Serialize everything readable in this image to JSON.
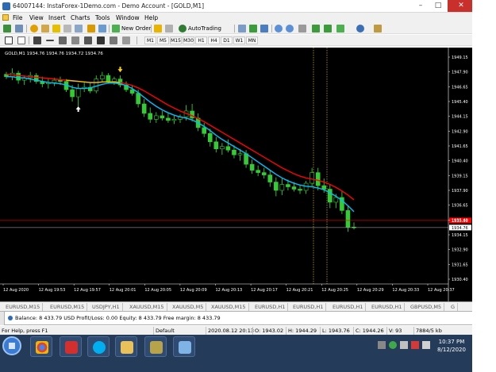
{
  "window": {
    "title": "64007144: InstaForex-1Demo.com - Demo Account - [GOLD,M1]",
    "min_glyph": "–",
    "max_glyph": "□",
    "close_glyph": "✕"
  },
  "menu": [
    "File",
    "View",
    "Insert",
    "Charts",
    "Tools",
    "Window",
    "Help"
  ],
  "toolbar": {
    "new_order": "New Order",
    "autotrading": "AutoTrading"
  },
  "timeframes": [
    "M1",
    "M5",
    "M15",
    "M30",
    "H1",
    "H4",
    "D1",
    "W1",
    "MN"
  ],
  "chart_data": {
    "type": "candlestick",
    "symbol_header": "GOLD,M1  1934.76 1934.76 1934.72 1934.76",
    "price_axis": [
      "1949.15",
      "1947.90",
      "1946.65",
      "1945.40",
      "1944.15",
      "1942.90",
      "1941.65",
      "1940.40",
      "1939.15",
      "1937.90",
      "1936.65",
      "1935.40",
      "1934.15",
      "1932.90",
      "1931.65",
      "1930.40"
    ],
    "current_price": "1934.76",
    "red_marker_price": "1935.36",
    "time_axis": [
      "12 Aug 2020",
      "12 Aug 19:53",
      "12 Aug 19:57",
      "12 Aug 20:01",
      "12 Aug 20:05",
      "12 Aug 20:09",
      "12 Aug 20:13",
      "12 Aug 20:17",
      "12 Aug 20:21",
      "12 Aug 20:25",
      "12 Aug 20:29",
      "12 Aug 20:33",
      "12 Aug 20:37"
    ],
    "ylim": [
      1930.4,
      1949.15
    ],
    "candles": [
      [
        1947.7,
        1947.9,
        1947.3,
        1947.5
      ],
      [
        1947.5,
        1948.2,
        1947.2,
        1947.8
      ],
      [
        1947.8,
        1948.0,
        1946.9,
        1947.2
      ],
      [
        1947.2,
        1947.6,
        1946.8,
        1947.4
      ],
      [
        1947.4,
        1947.9,
        1947.0,
        1947.6
      ],
      [
        1947.6,
        1947.8,
        1946.9,
        1947.1
      ],
      [
        1947.1,
        1947.5,
        1946.6,
        1946.9
      ],
      [
        1946.9,
        1947.3,
        1946.5,
        1947.0
      ],
      [
        1947.0,
        1947.4,
        1946.7,
        1947.2
      ],
      [
        1947.2,
        1947.5,
        1946.8,
        1947.1
      ],
      [
        1947.1,
        1947.3,
        1946.2,
        1946.4
      ],
      [
        1946.4,
        1946.8,
        1945.4,
        1945.8
      ],
      [
        1945.8,
        1946.9,
        1945.0,
        1946.5
      ],
      [
        1946.5,
        1947.0,
        1946.2,
        1946.6
      ],
      [
        1946.6,
        1947.0,
        1946.1,
        1946.3
      ],
      [
        1946.3,
        1947.6,
        1946.1,
        1947.3
      ],
      [
        1947.3,
        1947.9,
        1947.0,
        1947.6
      ],
      [
        1947.6,
        1947.8,
        1946.9,
        1947.1
      ],
      [
        1947.1,
        1947.5,
        1946.8,
        1947.3
      ],
      [
        1947.3,
        1947.6,
        1946.6,
        1946.8
      ],
      [
        1946.8,
        1947.1,
        1946.2,
        1946.4
      ],
      [
        1946.4,
        1946.8,
        1945.9,
        1946.1
      ],
      [
        1946.1,
        1946.4,
        1944.9,
        1945.2
      ],
      [
        1945.2,
        1945.6,
        1944.1,
        1944.4
      ],
      [
        1944.4,
        1944.9,
        1943.6,
        1943.9
      ],
      [
        1943.9,
        1944.5,
        1943.6,
        1944.2
      ],
      [
        1944.2,
        1944.6,
        1943.8,
        1944.0
      ],
      [
        1944.0,
        1944.4,
        1943.6,
        1943.8
      ],
      [
        1943.8,
        1944.2,
        1943.5,
        1943.9
      ],
      [
        1943.9,
        1944.3,
        1943.6,
        1944.1
      ],
      [
        1944.1,
        1945.1,
        1943.8,
        1944.6
      ],
      [
        1944.6,
        1945.2,
        1943.7,
        1944.0
      ],
      [
        1944.0,
        1944.4,
        1942.9,
        1943.2
      ],
      [
        1943.2,
        1943.6,
        1942.4,
        1942.7
      ],
      [
        1942.7,
        1943.1,
        1941.6,
        1942.0
      ],
      [
        1942.0,
        1942.4,
        1941.1,
        1941.4
      ],
      [
        1941.4,
        1941.9,
        1940.9,
        1941.6
      ],
      [
        1941.6,
        1942.2,
        1941.1,
        1941.3
      ],
      [
        1941.3,
        1941.7,
        1940.6,
        1940.9
      ],
      [
        1940.9,
        1941.4,
        1940.4,
        1941.0
      ],
      [
        1941.0,
        1941.3,
        1939.8,
        1940.1
      ],
      [
        1940.1,
        1940.5,
        1939.3,
        1939.6
      ],
      [
        1939.6,
        1940.0,
        1939.1,
        1939.4
      ],
      [
        1939.4,
        1939.8,
        1938.9,
        1939.2
      ],
      [
        1939.2,
        1939.6,
        1938.2,
        1938.6
      ],
      [
        1938.6,
        1939.0,
        1937.4,
        1937.9
      ],
      [
        1937.9,
        1938.9,
        1937.5,
        1938.4
      ],
      [
        1938.4,
        1938.8,
        1937.9,
        1938.2
      ],
      [
        1938.2,
        1938.6,
        1937.8,
        1938.0
      ],
      [
        1938.0,
        1938.3,
        1937.6,
        1937.9
      ],
      [
        1937.9,
        1938.7,
        1937.6,
        1938.5
      ],
      [
        1938.5,
        1939.8,
        1938.2,
        1939.4
      ],
      [
        1939.4,
        1939.8,
        1937.9,
        1938.3
      ],
      [
        1938.3,
        1938.9,
        1937.7,
        1938.0
      ],
      [
        1938.0,
        1938.4,
        1936.4,
        1936.9
      ],
      [
        1936.9,
        1937.6,
        1936.4,
        1937.3
      ],
      [
        1937.3,
        1937.8,
        1935.9,
        1936.2
      ],
      [
        1936.2,
        1936.6,
        1934.4,
        1934.8
      ],
      [
        1934.8,
        1935.2,
        1934.6,
        1934.76
      ]
    ],
    "ma_fast": [
      1947.5,
      1947.5,
      1947.4,
      1947.4,
      1947.3,
      1947.2,
      1947.1,
      1947.0,
      1946.95,
      1946.9,
      1946.8,
      1946.6,
      1946.5,
      1946.5,
      1946.55,
      1946.7,
      1946.85,
      1946.95,
      1946.95,
      1946.9,
      1946.75,
      1946.5,
      1946.15,
      1945.75,
      1945.35,
      1945.0,
      1944.7,
      1944.45,
      1944.25,
      1944.1,
      1944.0,
      1943.85,
      1943.6,
      1943.3,
      1942.95,
      1942.55,
      1942.2,
      1941.9,
      1941.6,
      1941.3,
      1941.0,
      1940.65,
      1940.3,
      1939.95,
      1939.6,
      1939.25,
      1938.95,
      1938.7,
      1938.5,
      1938.35,
      1938.25,
      1938.2,
      1938.1,
      1937.95,
      1937.7,
      1937.4,
      1937.05,
      1936.6,
      1936.1
    ],
    "ma_slow": [
      1947.7,
      1947.65,
      1947.6,
      1947.55,
      1947.5,
      1947.45,
      1947.4,
      1947.35,
      1947.3,
      1947.25,
      1947.2,
      1947.15,
      1947.1,
      1947.05,
      1947.0,
      1947.0,
      1947.05,
      1947.05,
      1947.05,
      1947.0,
      1946.9,
      1946.75,
      1946.55,
      1946.3,
      1946.0,
      1945.7,
      1945.4,
      1945.1,
      1944.85,
      1944.6,
      1944.4,
      1944.2,
      1943.95,
      1943.7,
      1943.4,
      1943.1,
      1942.8,
      1942.5,
      1942.2,
      1941.9,
      1941.6,
      1941.3,
      1941.0,
      1940.7,
      1940.4,
      1940.1,
      1939.8,
      1939.55,
      1939.3,
      1939.1,
      1938.95,
      1938.85,
      1938.75,
      1938.6,
      1938.4,
      1938.15,
      1937.85,
      1937.5,
      1937.1
    ]
  },
  "symbol_tabs": [
    "EURUSD,M15",
    "EURUSD,M15",
    "USDJPY,H1",
    "XAUUSD,M15",
    "XAUUSD,M5",
    "XAUUSD,M15",
    "EURUSD,H1",
    "EURUSD,H1",
    "EURUSD,H1",
    "EURUSD,H1",
    "GBPUSD,M5",
    "G"
  ],
  "terminal": {
    "text": "Balance: 8 433.79 USD  Profit/Loss: 0.00  Equity: 8 433.79  Free margin: 8 433.79"
  },
  "statusbar": {
    "help": "For Help, press F1",
    "profile": "Default",
    "datetime": "2020.08.12 20:13",
    "open": "O: 1943.02",
    "high": "H: 1944.29",
    "low": "L: 1943.76",
    "close": "C: 1944.26",
    "volume": "V: 93",
    "traffic": "7884/5 kb"
  },
  "taskbar": {
    "time": "10:37 PM",
    "date": "8/12/2020"
  },
  "colors": {
    "bullish": "#32cd32",
    "ma_fast": "#00bfff",
    "ma_slow": "#ff0000",
    "period_separator": "#c8a000",
    "price_line": "#c0c0c0",
    "red_line": "#ff0000"
  }
}
